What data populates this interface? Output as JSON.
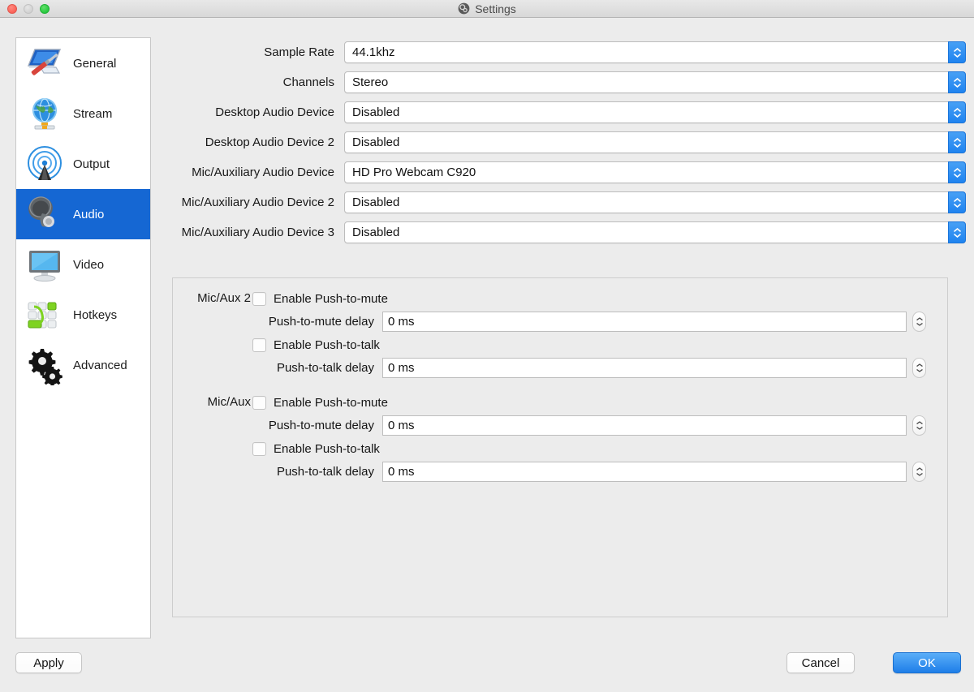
{
  "window": {
    "title": "Settings",
    "logo_icon": "obs-logo-icon",
    "traffic_lights": [
      {
        "name": "close-button",
        "label": "Close",
        "color": "#fb6258"
      },
      {
        "name": "minimize-button",
        "label": "Minimize",
        "color": "#d2d2d2"
      },
      {
        "name": "zoom-button",
        "label": "Zoom",
        "color": "#28c940"
      }
    ]
  },
  "sidebar": {
    "selected": "Audio",
    "selected_color": "#1567d3",
    "items": [
      {
        "label": "General",
        "icon": "general-monitor-screwdriver-icon",
        "selected": false
      },
      {
        "label": "Stream",
        "icon": "stream-globe-icon",
        "selected": false
      },
      {
        "label": "Output",
        "icon": "output-broadcast-icon",
        "selected": false
      },
      {
        "label": "Audio",
        "icon": "audio-speaker-icon",
        "selected": true
      },
      {
        "label": "Video",
        "icon": "video-monitor-icon",
        "selected": false
      },
      {
        "label": "Hotkeys",
        "icon": "hotkeys-keyboard-icon",
        "selected": false
      },
      {
        "label": "Advanced",
        "icon": "advanced-gears-icon",
        "selected": false
      }
    ]
  },
  "audio_settings": {
    "rows": [
      {
        "label": "Sample Rate",
        "value": "44.1khz"
      },
      {
        "label": "Channels",
        "value": "Stereo"
      },
      {
        "label": "Desktop Audio Device",
        "value": "Disabled"
      },
      {
        "label": "Desktop Audio Device 2",
        "value": "Disabled"
      },
      {
        "label": "Mic/Auxiliary Audio Device",
        "value": "HD Pro Webcam C920"
      },
      {
        "label": "Mic/Auxiliary Audio Device 2",
        "value": "Disabled"
      },
      {
        "label": "Mic/Auxiliary Audio Device 3",
        "value": "Disabled"
      }
    ]
  },
  "push_groups": [
    {
      "title": "Mic/Aux 2",
      "push_to_mute_label": "Enable Push-to-mute",
      "push_to_mute_checked": false,
      "push_to_mute_delay_label": "Push-to-mute delay",
      "push_to_mute_delay_value": "0 ms",
      "push_to_talk_label": "Enable Push-to-talk",
      "push_to_talk_checked": false,
      "push_to_talk_delay_label": "Push-to-talk delay",
      "push_to_talk_delay_value": "0 ms"
    },
    {
      "title": "Mic/Aux",
      "push_to_mute_label": "Enable Push-to-mute",
      "push_to_mute_checked": false,
      "push_to_mute_delay_label": "Push-to-mute delay",
      "push_to_mute_delay_value": "0 ms",
      "push_to_talk_label": "Enable Push-to-talk",
      "push_to_talk_checked": false,
      "push_to_talk_delay_label": "Push-to-talk delay",
      "push_to_talk_delay_value": "0 ms"
    }
  ],
  "footer": {
    "apply_label": "Apply",
    "cancel_label": "Cancel",
    "ok_label": "OK",
    "ok_accent_color": "#1e7ee8"
  }
}
